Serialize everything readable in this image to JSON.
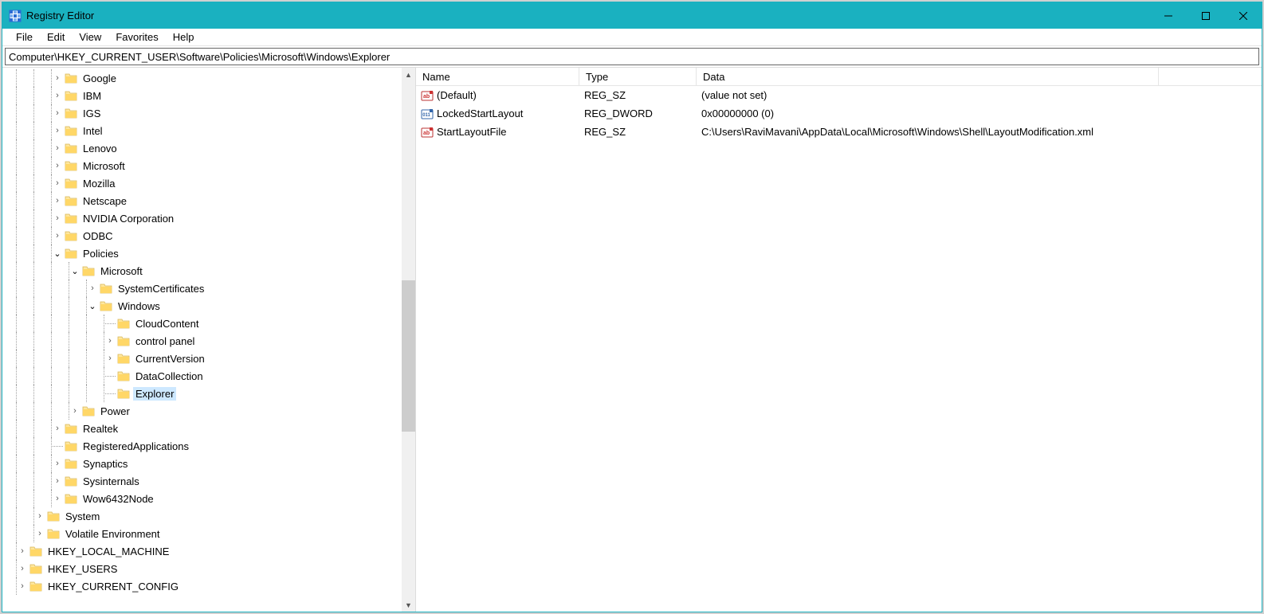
{
  "window": {
    "title": "Registry Editor"
  },
  "menu": {
    "file": "File",
    "edit": "Edit",
    "view": "View",
    "favorites": "Favorites",
    "help": "Help"
  },
  "address": "Computer\\HKEY_CURRENT_USER\\Software\\Policies\\Microsoft\\Windows\\Explorer",
  "tree": [
    {
      "indent": 3,
      "exp": "closed",
      "label": "Google"
    },
    {
      "indent": 3,
      "exp": "closed",
      "label": "IBM"
    },
    {
      "indent": 3,
      "exp": "closed",
      "label": "IGS"
    },
    {
      "indent": 3,
      "exp": "closed",
      "label": "Intel"
    },
    {
      "indent": 3,
      "exp": "closed",
      "label": "Lenovo"
    },
    {
      "indent": 3,
      "exp": "closed",
      "label": "Microsoft"
    },
    {
      "indent": 3,
      "exp": "closed",
      "label": "Mozilla"
    },
    {
      "indent": 3,
      "exp": "closed",
      "label": "Netscape"
    },
    {
      "indent": 3,
      "exp": "closed",
      "label": "NVIDIA Corporation"
    },
    {
      "indent": 3,
      "exp": "closed",
      "label": "ODBC"
    },
    {
      "indent": 3,
      "exp": "open",
      "label": "Policies"
    },
    {
      "indent": 4,
      "exp": "open",
      "label": "Microsoft"
    },
    {
      "indent": 5,
      "exp": "closed",
      "label": "SystemCertificates"
    },
    {
      "indent": 5,
      "exp": "open",
      "label": "Windows"
    },
    {
      "indent": 6,
      "exp": "none",
      "label": "CloudContent"
    },
    {
      "indent": 6,
      "exp": "closed",
      "label": "control panel"
    },
    {
      "indent": 6,
      "exp": "closed",
      "label": "CurrentVersion"
    },
    {
      "indent": 6,
      "exp": "none",
      "label": "DataCollection"
    },
    {
      "indent": 6,
      "exp": "none",
      "label": "Explorer",
      "selected": true
    },
    {
      "indent": 4,
      "exp": "closed",
      "label": "Power"
    },
    {
      "indent": 3,
      "exp": "closed",
      "label": "Realtek"
    },
    {
      "indent": 3,
      "exp": "none",
      "label": "RegisteredApplications"
    },
    {
      "indent": 3,
      "exp": "closed",
      "label": "Synaptics"
    },
    {
      "indent": 3,
      "exp": "closed",
      "label": "Sysinternals"
    },
    {
      "indent": 3,
      "exp": "closed",
      "label": "Wow6432Node"
    },
    {
      "indent": 2,
      "exp": "closed",
      "label": "System"
    },
    {
      "indent": 2,
      "exp": "closed",
      "label": "Volatile Environment"
    },
    {
      "indent": 1,
      "exp": "closed",
      "label": "HKEY_LOCAL_MACHINE"
    },
    {
      "indent": 1,
      "exp": "closed",
      "label": "HKEY_USERS"
    },
    {
      "indent": 1,
      "exp": "closed",
      "label": "HKEY_CURRENT_CONFIG"
    }
  ],
  "columns": {
    "name": "Name",
    "type": "Type",
    "data": "Data"
  },
  "values": [
    {
      "icon": "sz",
      "name": "(Default)",
      "type": "REG_SZ",
      "data": "(value not set)"
    },
    {
      "icon": "dw",
      "name": "LockedStartLayout",
      "type": "REG_DWORD",
      "data": "0x00000000 (0)"
    },
    {
      "icon": "sz",
      "name": "StartLayoutFile",
      "type": "REG_SZ",
      "data": "C:\\Users\\RaviMavani\\AppData\\Local\\Microsoft\\Windows\\Shell\\LayoutModification.xml"
    }
  ]
}
